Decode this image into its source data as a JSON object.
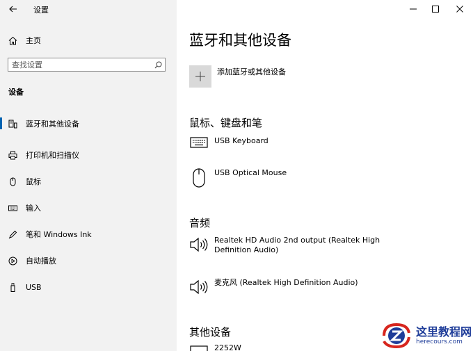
{
  "window": {
    "title": "设置",
    "controls": {
      "minimize": "minimize",
      "maximize": "maximize",
      "close": "close"
    }
  },
  "sidebar": {
    "home_label": "主页",
    "search_placeholder": "查找设置",
    "section_title": "设备",
    "items": [
      {
        "label": "蓝牙和其他设备",
        "icon": "bluetooth-devices-icon",
        "active": true
      },
      {
        "label": "打印机和扫描仪",
        "icon": "printer-icon",
        "active": false
      },
      {
        "label": "鼠标",
        "icon": "mouse-icon",
        "active": false
      },
      {
        "label": "输入",
        "icon": "keyboard-icon",
        "active": false
      },
      {
        "label": "笔和 Windows Ink",
        "icon": "pen-icon",
        "active": false
      },
      {
        "label": "自动播放",
        "icon": "autoplay-icon",
        "active": false
      },
      {
        "label": "USB",
        "icon": "usb-icon",
        "active": false
      }
    ]
  },
  "main": {
    "title": "蓝牙和其他设备",
    "add_label": "添加蓝牙或其他设备",
    "groups": [
      {
        "title": "鼠标、键盘和笔",
        "devices": [
          {
            "name": "USB Keyboard",
            "icon": "keyboard-icon"
          },
          {
            "name": "USB Optical Mouse",
            "icon": "mouse-icon"
          }
        ]
      },
      {
        "title": "音频",
        "devices": [
          {
            "name": "Realtek HD Audio 2nd output (Realtek High Definition Audio)",
            "icon": "speaker-icon"
          },
          {
            "name": "麦克风 (Realtek High Definition Audio)",
            "icon": "speaker-icon"
          }
        ]
      },
      {
        "title": "其他设备",
        "devices": [
          {
            "name": "2252W",
            "icon": "monitor-icon"
          }
        ]
      }
    ]
  },
  "watermark": {
    "title": "这里教程网",
    "url": "herecours.com",
    "colors": {
      "red": "#d7261e",
      "blue": "#1f3d99"
    }
  },
  "colors": {
    "accent": "#0063b1",
    "sidebar_bg": "#f2f2f2",
    "add_button_bg": "#d9d9d9"
  }
}
